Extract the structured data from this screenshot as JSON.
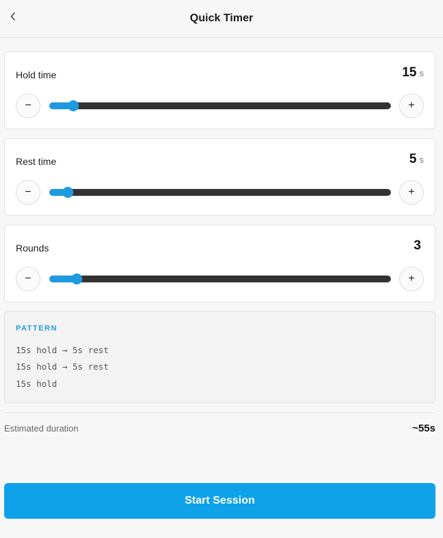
{
  "header": {
    "title": "Quick Timer",
    "back_icon": "chevron-left-icon"
  },
  "settings": [
    {
      "id": "hold",
      "label": "Hold time",
      "value": "15",
      "unit": "s",
      "level": 0.07
    },
    {
      "id": "rest",
      "label": "Rest time",
      "value": "5",
      "unit": "s",
      "level": 0.054
    },
    {
      "id": "rounds",
      "label": "Rounds",
      "value": "3",
      "unit": "",
      "level": 0.08
    }
  ],
  "stepper": {
    "minus_label": "−",
    "plus_label": "+"
  },
  "pattern": {
    "title": "PATTERN",
    "lines": [
      "15s hold → 5s rest",
      "15s hold → 5s rest",
      "15s hold"
    ]
  },
  "estimate": {
    "label": "Estimated duration",
    "value": "~55s"
  },
  "start_button": {
    "label": "Start Session"
  },
  "colors": {
    "accent": "#1f9ae0",
    "button": "#0fa2e8",
    "track": "#333333"
  }
}
